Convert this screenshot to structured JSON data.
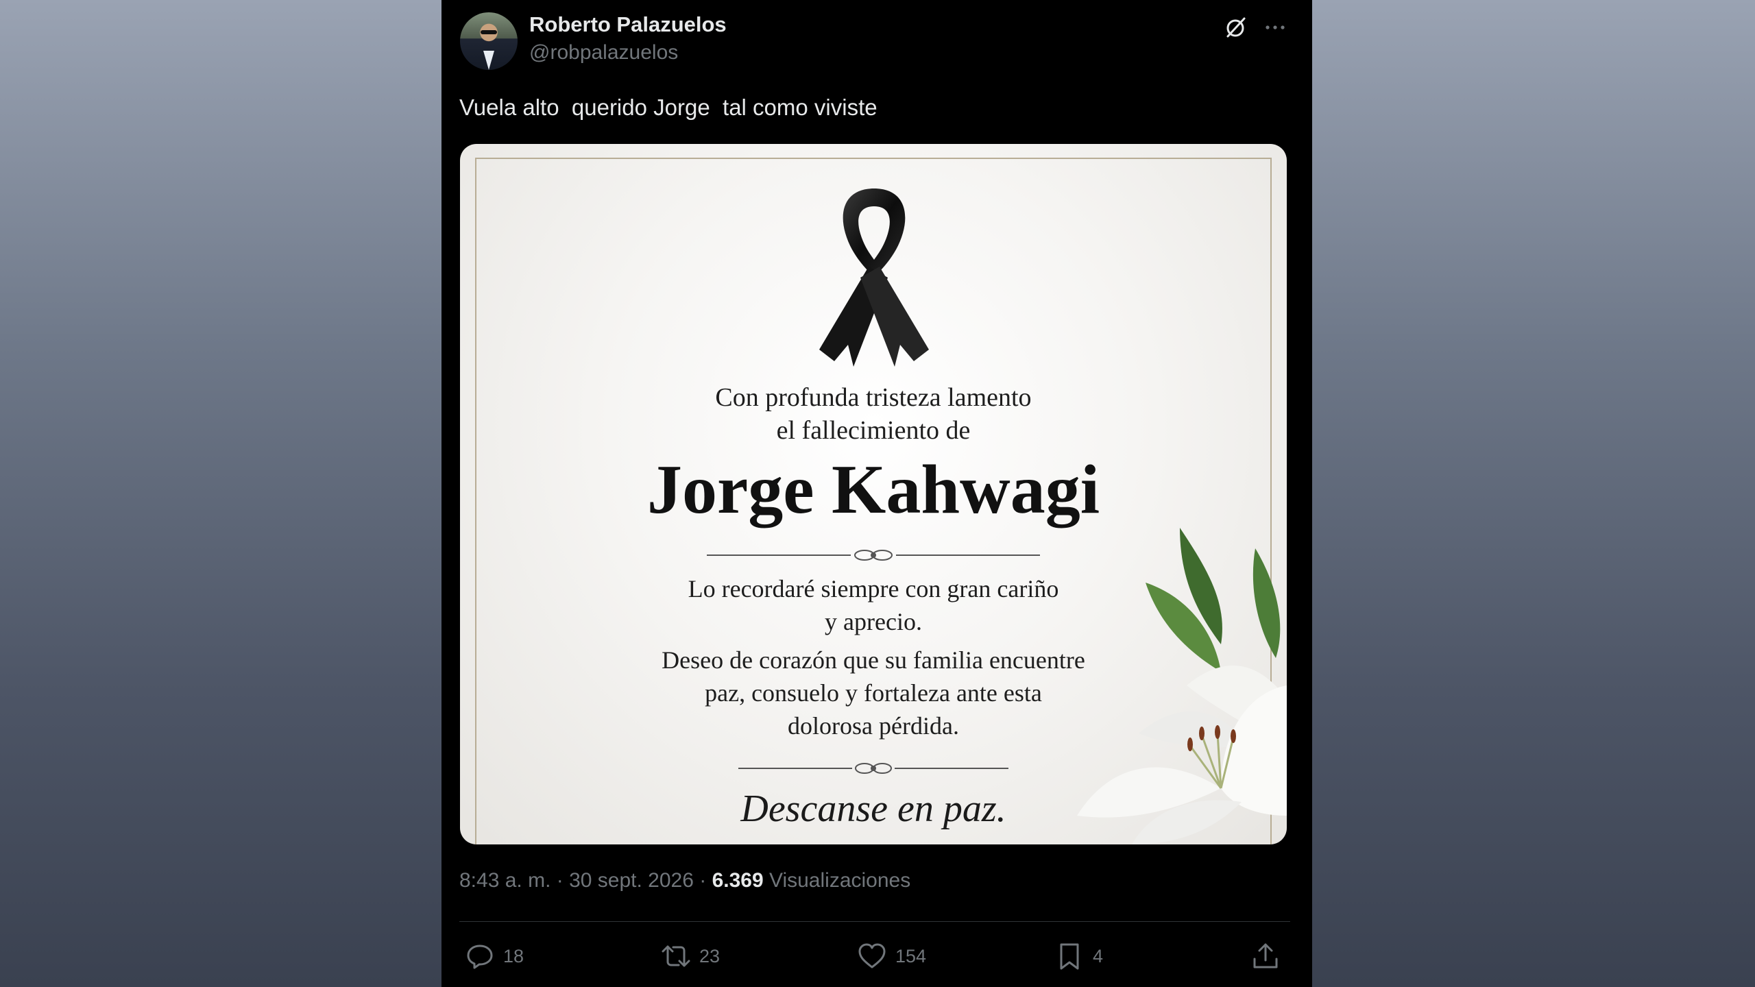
{
  "author": {
    "name": "Roberto Palazuelos",
    "handle": "@robpalazuelos"
  },
  "icons": [
    "grok-icon",
    "more-icon",
    "reply-icon",
    "retweet-icon",
    "like-icon",
    "bookmark-icon",
    "share-icon"
  ],
  "tweet_text": "Vuela alto  querido Jorge  tal como viviste",
  "card": {
    "line1": "Con profunda tristeza lamento",
    "line2": "el fallecimiento de",
    "name": "Jorge Kahwagi",
    "para1_line1": "Lo recordaré siempre con gran cariño",
    "para1_line2": "y aprecio.",
    "para2_line1": "Deseo de corazón que su familia encuentre",
    "para2_line2": "paz, consuelo y fortaleza ante esta",
    "para2_line3": "dolorosa pérdida.",
    "closing": "Descanse en paz."
  },
  "meta": {
    "time": "8:43 a. m.",
    "dot1": " · ",
    "date": "30 sept. 2026",
    "dot2": " · ",
    "views_count": "6.369",
    "views_label": " Visualizaciones"
  },
  "actions": {
    "replies": "18",
    "retweets": "23",
    "likes": "154",
    "bookmarks": "4"
  },
  "colors": {
    "background": "#000000",
    "text": "#e7e9ea",
    "muted": "#71767b",
    "divider": "#2f3336"
  }
}
